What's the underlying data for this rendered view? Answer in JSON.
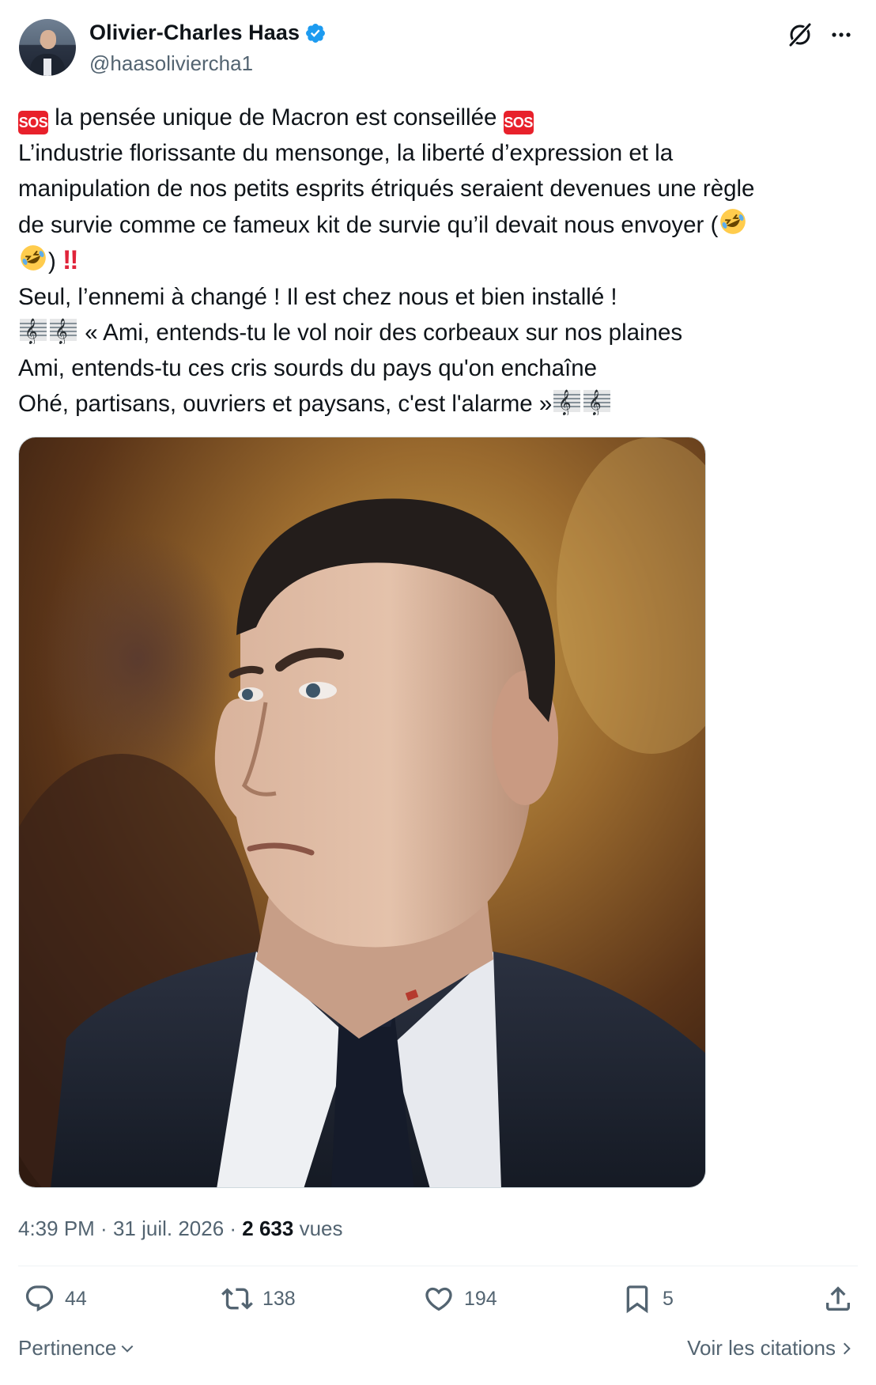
{
  "author": {
    "name": "Olivier-Charles Haas",
    "handle": "@haasoliviercha1",
    "verified": true
  },
  "tweet": {
    "lines": [
      {
        "pre_emoji": "🆘",
        "text": " la pensée unique de Macron est conseillée ",
        "post_emoji": "🆘"
      },
      {
        "text": "L’industrie florissante du mensonge, la liberté d’expression et la"
      },
      {
        "text": "manipulation de nos petits esprits étriqués seraient devenues une règle"
      },
      {
        "text": "de survie comme ce fameux kit de survie qu’il devait nous envoyer ("
      },
      {
        "text": ") "
      },
      {
        "text": "Seul, l’ennemi à changé ! Il est chez nous et bien installé !"
      },
      {
        "text": " « Ami, entends-tu le vol noir des corbeaux sur nos plaines"
      },
      {
        "text": "Ami, entends-tu ces cris sourds du pays qu'on enchaîne"
      },
      {
        "text": "Ohé, partisans, ouvriers et paysans, c'est l'alarme »"
      }
    ],
    "sos_label": "SOS",
    "bang": "‼",
    "emojis": {
      "sos": "sos-icon",
      "rofl": "rofl-emoji",
      "score": "musical-score-emoji",
      "bang": "double-exclamation-emoji"
    }
  },
  "meta": {
    "time": "4:39 PM",
    "sep": " · ",
    "date": "31 juil. 2026",
    "views_count": "2 633",
    "views_label": " vues"
  },
  "actions": {
    "replies": "44",
    "reposts": "138",
    "likes": "194",
    "bookmarks": "5"
  },
  "footer": {
    "sort_label": "Pertinence",
    "quotes_label": "Voir les citations"
  },
  "colors": {
    "text": "#0f1419",
    "secondary": "#536471",
    "verified": "#1d9bf0",
    "sos": "#e8212b"
  }
}
